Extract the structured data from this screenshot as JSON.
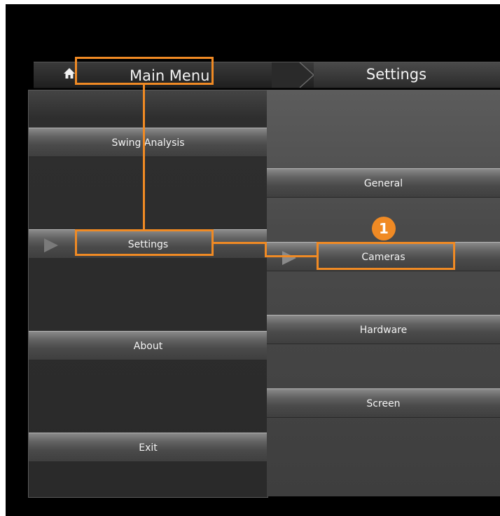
{
  "header": {
    "home_icon": "home-icon",
    "breadcrumb_root": "Main Menu",
    "breadcrumb_current": "Settings"
  },
  "main_menu": {
    "items": [
      {
        "label": "Swing Analysis"
      },
      {
        "label": "Settings",
        "selected": true
      },
      {
        "label": "About"
      },
      {
        "label": "Exit"
      }
    ]
  },
  "settings_menu": {
    "items": [
      {
        "label": "General"
      },
      {
        "label": "Cameras",
        "selected": true
      },
      {
        "label": "Hardware"
      },
      {
        "label": "Screen"
      }
    ]
  },
  "annotation": {
    "step_number": "1",
    "accent_color": "#f08a24"
  }
}
